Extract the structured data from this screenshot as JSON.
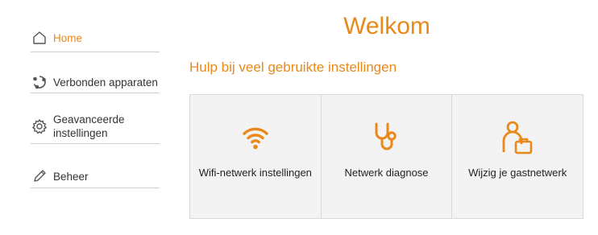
{
  "sidebar": {
    "items": [
      {
        "label": "Home",
        "icon": "home-icon",
        "active": true
      },
      {
        "label": "Verbonden apparaten",
        "icon": "devices-icon",
        "active": false
      },
      {
        "label": "Geavanceerde instellingen",
        "icon": "gear-icon",
        "active": false
      },
      {
        "label": "Beheer",
        "icon": "pencil-icon",
        "active": false
      }
    ]
  },
  "main": {
    "title": "Welkom",
    "subtitle": "Hulp bij veel gebruikte instellingen",
    "cards": [
      {
        "label": "Wifi-netwerk instellingen",
        "icon": "wifi-icon"
      },
      {
        "label": "Netwerk diagnose",
        "icon": "stethoscope-icon"
      },
      {
        "label": "Wijzig je gastnetwerk",
        "icon": "guest-icon"
      }
    ]
  },
  "colors": {
    "accent": "#e8891a",
    "text": "#333333",
    "card_bg": "#f3f3f3",
    "divider": "#cfcfcf"
  }
}
